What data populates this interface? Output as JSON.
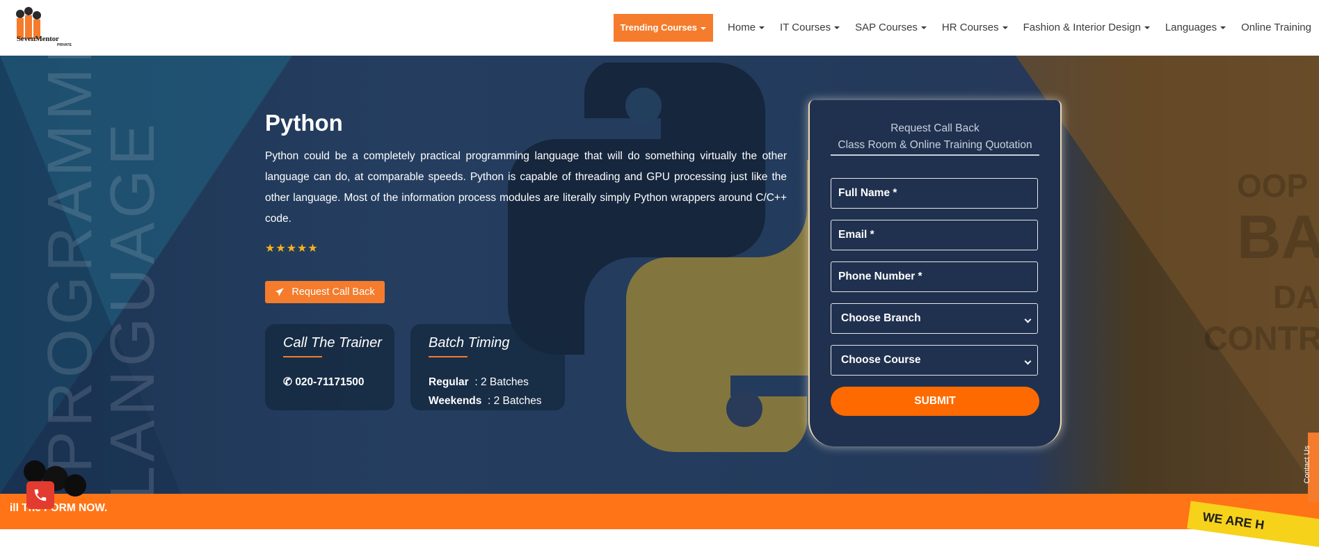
{
  "brand": {
    "logo_text": "SevenMentor",
    "logo_sub": "PRIVATE"
  },
  "nav": {
    "trending": "Trending Courses",
    "items": [
      "Home",
      "IT Courses",
      "SAP Courses",
      "HR Courses",
      "Fashion & Interior Design",
      "Languages",
      "Online Training"
    ]
  },
  "hero": {
    "bg_left_1": "PROGRAMMING",
    "bg_left_2": "LANGUAGE",
    "bg_right": [
      "OOP",
      "BA",
      "DA",
      "CONTRO"
    ],
    "title": "Python",
    "description": "Python could be a completely practical programming language that will do something virtually the other language can do, at comparable speeds. Python is capable of threading and GPU processing just like the other language. Most of the information process modules are literally simply Python wrappers around C/C++ code.",
    "stars": "★★★★★",
    "rating": 5,
    "request_button": "Request Call Back",
    "call_card": {
      "title": "Call The Trainer",
      "phone": "020-71171500"
    },
    "batch_card": {
      "title": "Batch Timing",
      "regular_label": "Regular",
      "regular_value": ": 2 Batches",
      "weekends_label": "Weekends",
      "weekends_value": ": 2 Batches"
    }
  },
  "form": {
    "heading_1": "Request Call Back",
    "heading_2": "Class Room & Online Training Quotation",
    "full_name_placeholder": "Full Name *",
    "email_placeholder": "Email *",
    "phone_placeholder": "Phone Number *",
    "branch_select": "Choose Branch",
    "course_select": "Choose Course",
    "submit": "SUBMIT"
  },
  "footer": {
    "ticker": "ill The FORM NOW.",
    "badge": "WE ARE H",
    "contact_tab": "Contact Us"
  },
  "colors": {
    "accent": "#f47c2c",
    "panel": "#20314f",
    "hero_bg": "#233b5c",
    "star": "#f6b21a"
  }
}
